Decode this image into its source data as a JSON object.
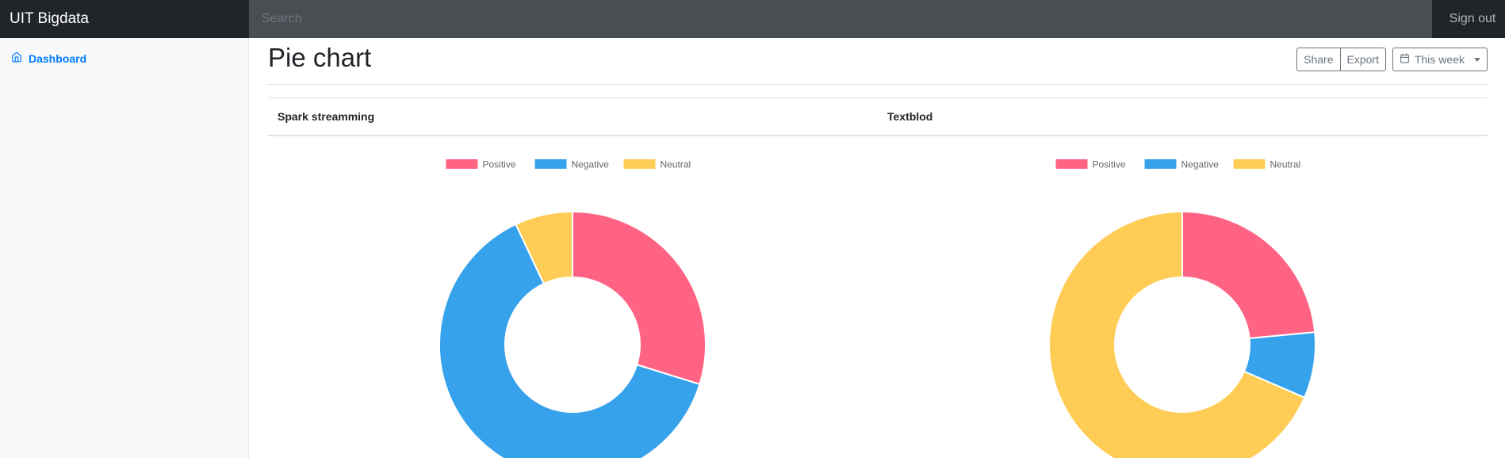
{
  "topbar": {
    "brand": "UIT Bigdata",
    "search_placeholder": "Search",
    "signout_label": "Sign out"
  },
  "sidebar": {
    "items": [
      {
        "label": "Dashboard",
        "icon": "home-icon"
      }
    ]
  },
  "main": {
    "title": "Pie chart",
    "toolbar": {
      "share_label": "Share",
      "export_label": "Export",
      "range_label": "This week",
      "range_icon": "calendar-icon"
    },
    "columns": [
      {
        "title": "Spark streamming"
      },
      {
        "title": "Textblod"
      }
    ]
  },
  "colors": {
    "positive": "#ff6384",
    "negative": "#36a2eb",
    "neutral": "#ffcd56"
  },
  "chart_data": [
    {
      "type": "pie",
      "variant": "doughnut",
      "legend_position": "top",
      "categories": [
        "Positive",
        "Negative",
        "Neutral"
      ],
      "values": [
        29.8,
        63.2,
        7.0
      ],
      "colors": [
        "#ff6384",
        "#36a2eb",
        "#ffcd56"
      ]
    },
    {
      "type": "pie",
      "variant": "doughnut",
      "legend_position": "top",
      "categories": [
        "Positive",
        "Negative",
        "Neutral"
      ],
      "values": [
        23.5,
        8.0,
        68.5
      ],
      "colors": [
        "#ff6384",
        "#36a2eb",
        "#ffcd56"
      ]
    }
  ]
}
